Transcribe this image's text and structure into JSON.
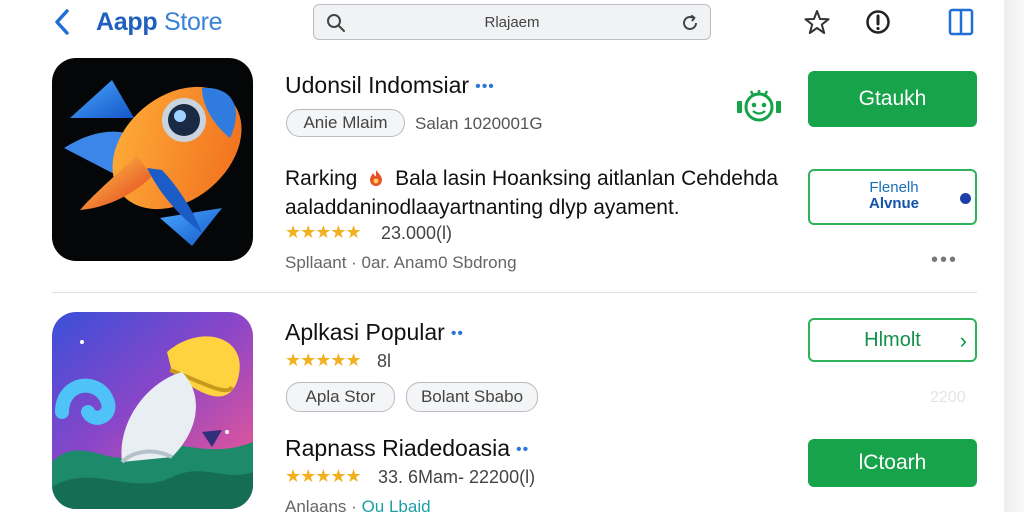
{
  "header": {
    "title_part1": "Aapp",
    "title_part2": " Store",
    "search_value": "Rlajaem"
  },
  "apps": [
    {
      "name": "Udonsil Indomsiar",
      "chip": "Anie Mlaim",
      "meta": "Salan 1020001G",
      "ranking_label": "Rarking",
      "desc_line1": "Bala lasin Hoanksing aitlanlan Cehdehda",
      "desc_line2": "aaladdaninodlaayartnanting dlyp ayament.",
      "stars": "★★★★★",
      "rating": "23.000(l)",
      "sub": "Spllaant · 0ar. Anam0 Sbdrong",
      "primary_btn": "Gtaukh",
      "secondary_btn_line1": "Flenelh",
      "secondary_btn_line2": "Alvnue",
      "more": "•••"
    },
    {
      "name": "Aplkasi Popular",
      "stars": "★★★★★",
      "rating": "8l",
      "chip1": "Apla Stor",
      "chip2": "Bolant Sbabo",
      "btn": "Hlmolt",
      "btn_arrow": "›",
      "faint_num": "2200"
    },
    {
      "name": "Rapnass Riadedoasia",
      "stars": "★★★★★",
      "rating": "33. 6Mam- 22200(l)",
      "sub_prefix": "Anlaans ·",
      "sub_link": "Ou Lbaid",
      "btn": "lCtoarh"
    }
  ],
  "colors": {
    "accent_blue": "#1f5fbf",
    "green": "#17a34a",
    "star": "#f2b01e"
  },
  "icons": [
    "chevron-left-icon",
    "search-icon",
    "refresh-icon",
    "star-icon",
    "alert-icon",
    "tablet-icon",
    "robot-badge-icon"
  ]
}
